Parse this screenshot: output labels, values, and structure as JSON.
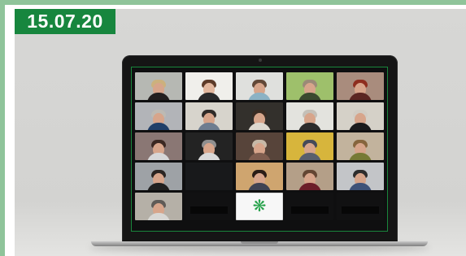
{
  "header": {
    "date_label": "15.07.20"
  },
  "colors": {
    "accent_green": "#17863e",
    "frame_green": "#8fc49a",
    "background_gray": "#d7d7d5",
    "laptop_black": "#151515"
  },
  "meeting": {
    "app_view": "video-grid",
    "tiles": [
      {
        "type": "video",
        "label": ""
      },
      {
        "type": "video",
        "label": ""
      },
      {
        "type": "video",
        "label": ""
      },
      {
        "type": "video",
        "label": ""
      },
      {
        "type": "video",
        "label": ""
      },
      {
        "type": "video",
        "label": ""
      },
      {
        "type": "video",
        "label": ""
      },
      {
        "type": "video",
        "label": ""
      },
      {
        "type": "video",
        "label": ""
      },
      {
        "type": "video",
        "label": ""
      },
      {
        "type": "video",
        "label": ""
      },
      {
        "type": "video",
        "label": ""
      },
      {
        "type": "video",
        "label": ""
      },
      {
        "type": "video",
        "label": ""
      },
      {
        "type": "video",
        "label": ""
      },
      {
        "type": "video",
        "label": ""
      },
      {
        "type": "blank",
        "label": ""
      },
      {
        "type": "video",
        "label": ""
      },
      {
        "type": "video",
        "label": ""
      },
      {
        "type": "video",
        "label": ""
      },
      {
        "type": "video",
        "label": ""
      },
      {
        "type": "dark",
        "label": ""
      },
      {
        "type": "logo",
        "label": ""
      },
      {
        "type": "dark",
        "label": ""
      },
      {
        "type": "dark",
        "label": ""
      }
    ],
    "logo_icon": "green-asterisk-logo"
  }
}
